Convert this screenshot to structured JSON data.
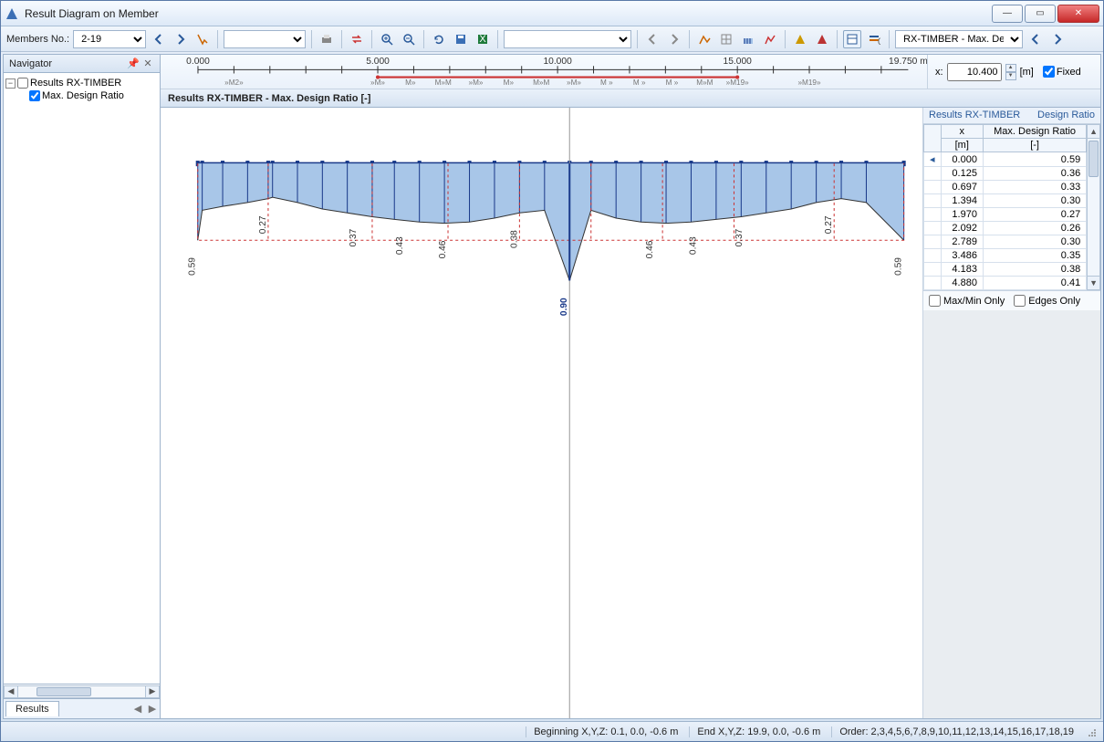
{
  "window": {
    "title": "Result Diagram on Member"
  },
  "toolbar": {
    "members_label": "Members No.:",
    "members_value": "2-19",
    "results_module": "RX-TIMBER -  Max. Desigr"
  },
  "navigator": {
    "title": "Navigator",
    "root": "Results RX-TIMBER",
    "child": "Max. Design Ratio",
    "tab": "Results"
  },
  "ruler": {
    "ticks": [
      "0.000",
      "5.000",
      "10.000",
      "15.000",
      "19.750 m"
    ],
    "m2": "»M2»",
    "m19": "»M19»",
    "mseq": [
      "»M»",
      "M»",
      "M»M",
      "»M»",
      "M»",
      "M»M",
      "»M»",
      "M »",
      "M »",
      "M »",
      "M»M",
      "»M19»"
    ]
  },
  "xbox": {
    "label": "x:",
    "value": "10.400",
    "unit": "[m]",
    "fixed_label": "Fixed"
  },
  "diagram": {
    "header": "Results RX-TIMBER - Max. Design Ratio [-]",
    "labels": [
      "0.59",
      "0.27",
      "0.37",
      "0.43",
      "0.46",
      "0.38",
      "0.46",
      "0.43",
      "0.37",
      "0.27",
      "0.59"
    ],
    "max_label": "0.90"
  },
  "rightpanel": {
    "hdr_left": "Results RX-TIMBER",
    "hdr_right": "Design Ratio",
    "col1a": "x",
    "col1b": "[m]",
    "col2a": "Max. Design Ratio",
    "col2b": "[-]",
    "rows": [
      {
        "x": "0.000",
        "v": "0.59",
        "ptr": true
      },
      {
        "x": "0.125",
        "v": "0.36"
      },
      {
        "x": "0.697",
        "v": "0.33"
      },
      {
        "x": "1.394",
        "v": "0.30"
      },
      {
        "x": "1.970",
        "v": "0.27"
      },
      {
        "x": "2.092",
        "v": "0.26"
      },
      {
        "x": "2.789",
        "v": "0.30"
      },
      {
        "x": "3.486",
        "v": "0.35"
      },
      {
        "x": "4.183",
        "v": "0.38"
      },
      {
        "x": "4.880",
        "v": "0.41"
      }
    ],
    "maxmin_label": "Max/Min Only",
    "edges_label": "Edges Only"
  },
  "status": {
    "begin": "Beginning X,Y,Z:   0.1, 0.0, -0.6 m",
    "end": "End X,Y,Z:   19.9, 0.0, -0.6 m",
    "order": "Order:   2,3,4,5,6,7,8,9,10,11,12,13,14,15,16,17,18,19"
  },
  "chart_data": {
    "type": "area",
    "title": "Results RX-TIMBER - Max. Design Ratio [-]",
    "xlabel": "x [m]",
    "ylabel": "Max. Design Ratio [-]",
    "xlim": [
      0,
      19.75
    ],
    "ylim": [
      0,
      0.9
    ],
    "x": [
      0.0,
      0.125,
      0.697,
      1.394,
      1.97,
      2.092,
      2.789,
      3.486,
      4.183,
      4.88,
      5.5,
      6.2,
      6.9,
      7.6,
      8.3,
      9.0,
      9.7,
      10.4,
      11.0,
      11.7,
      12.4,
      13.1,
      13.8,
      14.5,
      15.2,
      15.9,
      16.6,
      17.3,
      18.0,
      18.7,
      19.75
    ],
    "values": [
      0.59,
      0.36,
      0.33,
      0.3,
      0.27,
      0.26,
      0.3,
      0.35,
      0.38,
      0.41,
      0.43,
      0.45,
      0.46,
      0.45,
      0.42,
      0.38,
      0.36,
      0.9,
      0.36,
      0.42,
      0.45,
      0.46,
      0.45,
      0.43,
      0.41,
      0.38,
      0.35,
      0.3,
      0.27,
      0.3,
      0.59
    ],
    "annotations": [
      {
        "x": 0.0,
        "v": 0.59,
        "label": "0.59"
      },
      {
        "x": 1.97,
        "v": 0.27,
        "label": "0.27"
      },
      {
        "x": 4.5,
        "v": 0.37,
        "label": "0.37"
      },
      {
        "x": 5.8,
        "v": 0.43,
        "label": "0.43"
      },
      {
        "x": 7.0,
        "v": 0.46,
        "label": "0.46"
      },
      {
        "x": 9.0,
        "v": 0.38,
        "label": "0.38"
      },
      {
        "x": 12.8,
        "v": 0.46,
        "label": "0.46"
      },
      {
        "x": 14.0,
        "v": 0.43,
        "label": "0.43"
      },
      {
        "x": 15.3,
        "v": 0.37,
        "label": "0.37"
      },
      {
        "x": 17.8,
        "v": 0.27,
        "label": "0.27"
      },
      {
        "x": 19.75,
        "v": 0.59,
        "label": "0.59"
      },
      {
        "x": 10.4,
        "v": 0.9,
        "label": "0.90",
        "bold": true
      }
    ]
  }
}
